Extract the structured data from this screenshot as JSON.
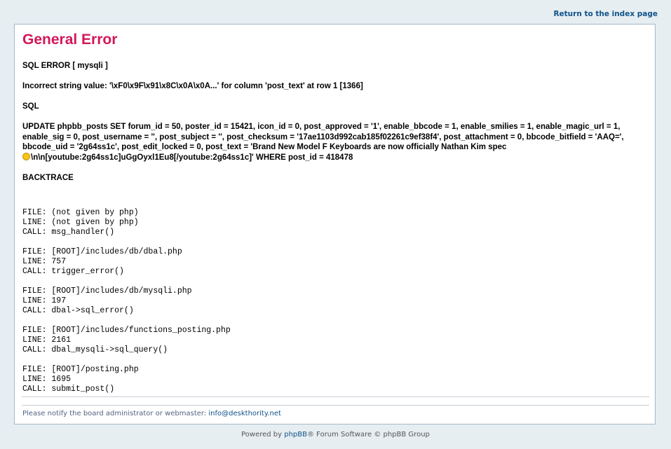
{
  "top_nav": {
    "return_link": "Return to the index page"
  },
  "error": {
    "title": "General Error",
    "sql_error_label": "SQL ERROR [ mysqli ]",
    "message": "Incorrect string value: '\\xF0\\x9F\\x91\\x8C\\x0A\\x0A...' for column 'post_text' at row 1 [1366]",
    "sql_label": "SQL",
    "query_text": "UPDATE phpbb_posts SET forum_id = 50, poster_id = 15421, icon_id = 0, post_approved = '1', enable_bbcode = 1, enable_smilies = 1, enable_magic_url = 1, enable_sig = 0, post_username = '', post_subject = '', post_checksum = '17ae1103d992cab185f02261c9ef38f4', post_attachment = 0, bbcode_bitfield = 'AAQ=', bbcode_uid = '2g64ss1c', post_edit_locked = 0, post_text = 'Brand New Model F Keyboards are now officially Nathan Kim spec",
    "query_text_end": "\\n\\n[youtube:2g64ss1c]uGgOyxl1Eu8[/youtube:2g64ss1c]' WHERE post_id = 418478",
    "backtrace_label": "BACKTRACE",
    "backtrace": "FILE: (not given by php)\nLINE: (not given by php)\nCALL: msg_handler()\n\nFILE: [ROOT]/includes/db/dbal.php\nLINE: 757\nCALL: trigger_error()\n\nFILE: [ROOT]/includes/db/mysqli.php\nLINE: 197\nCALL: dbal->sql_error()\n\nFILE: [ROOT]/includes/functions_posting.php\nLINE: 2161\nCALL: dbal_mysqli->sql_query()\n\nFILE: [ROOT]/posting.php\nLINE: 1695\nCALL: submit_post()"
  },
  "footer": {
    "notify_text": "Please notify the board administrator or webmaster: ",
    "email": "info@deskthority.net"
  },
  "powered": {
    "prefix": "Powered by ",
    "phpbb": "phpBB",
    "suffix": "® Forum Software © phpBB Group"
  }
}
